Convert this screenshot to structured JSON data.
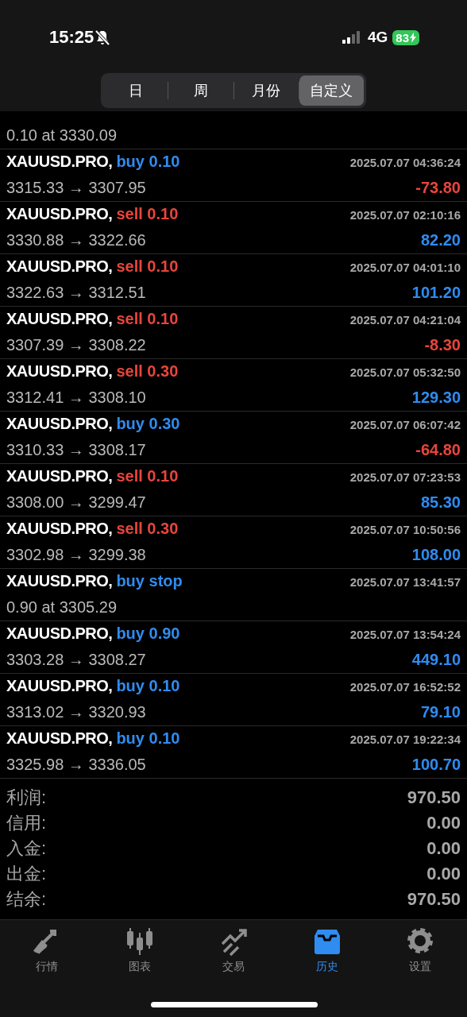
{
  "status_bar": {
    "time": "15:25",
    "network": "4G",
    "battery": "83"
  },
  "period_tabs": [
    {
      "label": "日",
      "selected": false
    },
    {
      "label": "周",
      "selected": false
    },
    {
      "label": "月份",
      "selected": false
    },
    {
      "label": "自定义",
      "selected": true
    }
  ],
  "history": [
    {
      "kind": "partial",
      "detail": "0.10 at 3330.09"
    },
    {
      "kind": "deal",
      "symbol": "XAUUSD.PRO,",
      "action": "buy 0.10",
      "sell": false,
      "time": "2025.07.07 04:36:24",
      "detail": "3315.33 → 3307.95",
      "profit": "-73.80",
      "loss": true
    },
    {
      "kind": "deal",
      "symbol": "XAUUSD.PRO,",
      "action": "sell 0.10",
      "sell": true,
      "time": "2025.07.07 02:10:16",
      "detail": "3330.88 → 3322.66",
      "profit": "82.20",
      "loss": false
    },
    {
      "kind": "deal",
      "symbol": "XAUUSD.PRO,",
      "action": "sell 0.10",
      "sell": true,
      "time": "2025.07.07 04:01:10",
      "detail": "3322.63 → 3312.51",
      "profit": "101.20",
      "loss": false
    },
    {
      "kind": "deal",
      "symbol": "XAUUSD.PRO,",
      "action": "sell 0.10",
      "sell": true,
      "time": "2025.07.07 04:21:04",
      "detail": "3307.39 → 3308.22",
      "profit": "-8.30",
      "loss": true
    },
    {
      "kind": "deal",
      "symbol": "XAUUSD.PRO,",
      "action": "sell 0.30",
      "sell": true,
      "time": "2025.07.07 05:32:50",
      "detail": "3312.41 → 3308.10",
      "profit": "129.30",
      "loss": false
    },
    {
      "kind": "deal",
      "symbol": "XAUUSD.PRO,",
      "action": "buy 0.30",
      "sell": false,
      "time": "2025.07.07 06:07:42",
      "detail": "3310.33 → 3308.17",
      "profit": "-64.80",
      "loss": true
    },
    {
      "kind": "deal",
      "symbol": "XAUUSD.PRO,",
      "action": "sell 0.10",
      "sell": true,
      "time": "2025.07.07 07:23:53",
      "detail": "3308.00 → 3299.47",
      "profit": "85.30",
      "loss": false
    },
    {
      "kind": "deal",
      "symbol": "XAUUSD.PRO,",
      "action": "sell 0.30",
      "sell": true,
      "time": "2025.07.07 10:50:56",
      "detail": "3302.98 → 3299.38",
      "profit": "108.00",
      "loss": false
    },
    {
      "kind": "order",
      "symbol": "XAUUSD.PRO,",
      "action": "buy stop",
      "sell": false,
      "time": "2025.07.07 13:41:57",
      "detail": "0.90 at 3305.29"
    },
    {
      "kind": "deal",
      "symbol": "XAUUSD.PRO,",
      "action": "buy 0.90",
      "sell": false,
      "time": "2025.07.07 13:54:24",
      "detail": "3303.28 → 3308.27",
      "profit": "449.10",
      "loss": false
    },
    {
      "kind": "deal",
      "symbol": "XAUUSD.PRO,",
      "action": "buy 0.10",
      "sell": false,
      "time": "2025.07.07 16:52:52",
      "detail": "3313.02 → 3320.93",
      "profit": "79.10",
      "loss": false
    },
    {
      "kind": "deal",
      "symbol": "XAUUSD.PRO,",
      "action": "buy 0.10",
      "sell": false,
      "time": "2025.07.07 19:22:34",
      "detail": "3325.98 → 3336.05",
      "profit": "100.70",
      "loss": false
    }
  ],
  "summary": [
    {
      "label": "利润:",
      "value": "970.50"
    },
    {
      "label": "信用:",
      "value": "0.00"
    },
    {
      "label": "入金:",
      "value": "0.00"
    },
    {
      "label": "出金:",
      "value": "0.00"
    },
    {
      "label": "结余:",
      "value": "970.50"
    }
  ],
  "tab_bar": [
    {
      "kind": "quotes",
      "label": "行情",
      "selected": false
    },
    {
      "kind": "chart",
      "label": "图表",
      "selected": false
    },
    {
      "kind": "trade",
      "label": "交易",
      "selected": false
    },
    {
      "kind": "history",
      "label": "历史",
      "selected": true
    },
    {
      "kind": "settings",
      "label": "设置",
      "selected": false
    }
  ]
}
